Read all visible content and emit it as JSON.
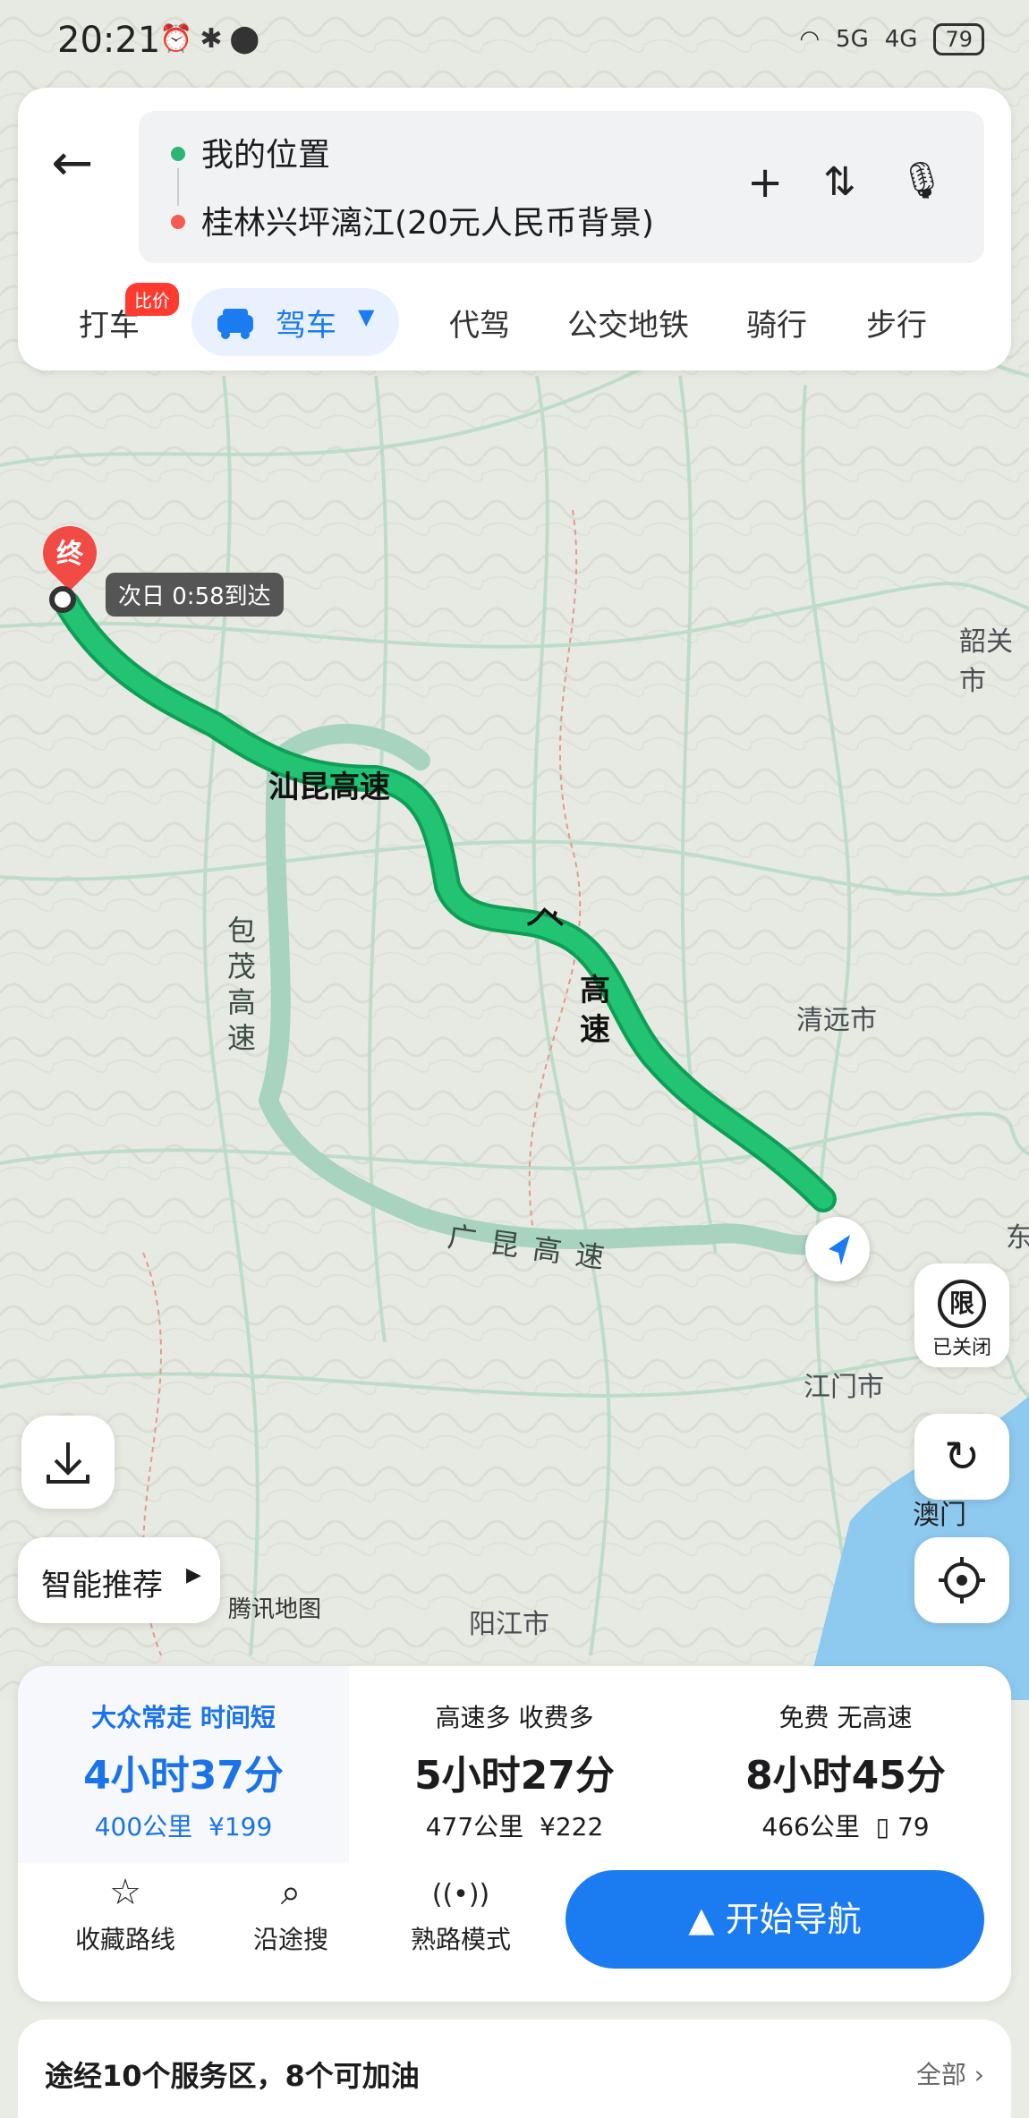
{
  "status_bar": {
    "time": "20:21",
    "signal_5g": "5G",
    "signal_4g": "4G",
    "battery": "79"
  },
  "header": {
    "back_icon": "arrow-left-icon",
    "origin": "我的位置",
    "destination": "桂林兴坪漓江(20元人民币背景)",
    "origin_color": "#2bb673",
    "destination_color": "#f25c54"
  },
  "modes": {
    "taxi": "打车",
    "taxi_badge": "比价",
    "drive": "驾车",
    "chauffeur": "代驾",
    "transit": "公交地铁",
    "bike": "骑行",
    "walk": "步行"
  },
  "map": {
    "end_marker": "终",
    "arrival": "次日 0:58到达",
    "road_main": "汕昆高速",
    "road_main2_a": "广",
    "road_main2_b": "高速",
    "road_alt1": "包茂高速",
    "road_alt2": "广昆高速",
    "city_qingyuan": "清远市",
    "city_shaoguan": "韶关市",
    "city_jiangmen": "江门市",
    "city_yangjiang": "阳江市",
    "city_macau": "澳门",
    "edge_east": "东",
    "attribution": "腾讯地图",
    "restriction_icon": "限",
    "restriction_label": "已关闭",
    "smart_recommend": "智能推荐",
    "route_green": "#1fb86a",
    "route_alt": "#a8d3be"
  },
  "routes": [
    {
      "tag": "大众常走 时间短",
      "duration": "4小时37分",
      "distance": "400公里",
      "toll": "¥199",
      "selected": true
    },
    {
      "tag": "高速多 收费多",
      "duration": "5小时27分",
      "distance": "477公里",
      "toll": "¥222",
      "selected": false
    },
    {
      "tag": "免费 无高速",
      "duration": "8小时45分",
      "distance": "466公里",
      "toll": "79",
      "selected": false
    }
  ],
  "actions": {
    "favorite": "收藏路线",
    "search_along": "沿途搜",
    "familiar": "熟路模式",
    "start_nav": "开始导航"
  },
  "services": {
    "summary": "途经10个服务区，8个可加油",
    "all": "全部"
  },
  "accent": "#1b7bf0"
}
